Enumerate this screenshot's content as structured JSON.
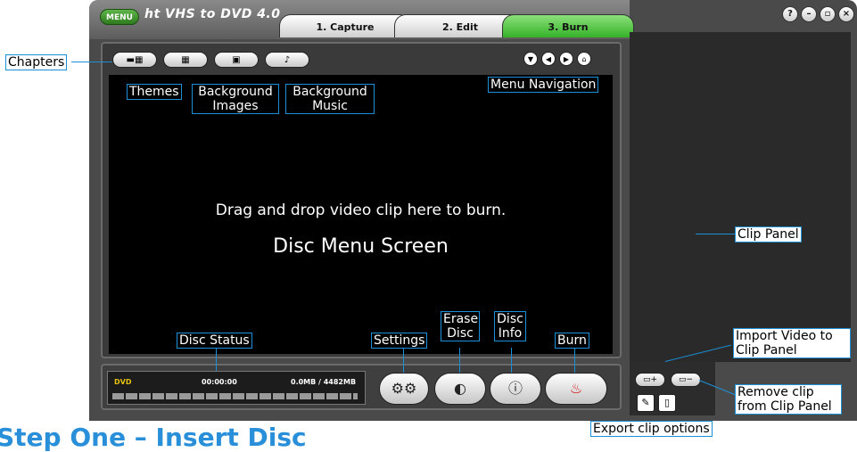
{
  "app": {
    "menu_label": "MENU",
    "logo_prefix": "ht",
    "logo_text": "VHS to DVD 4.0"
  },
  "tabs": [
    {
      "label": "1. Capture",
      "active": false
    },
    {
      "label": "2. Edit",
      "active": false
    },
    {
      "label": "3. Burn",
      "active": true
    }
  ],
  "window_controls": {
    "help": "?",
    "minimize": "–",
    "maximize": "▫",
    "close": "×"
  },
  "disc_menu": {
    "drag_text": "Drag and drop video clip here to burn.",
    "screen_title": "Disc Menu Screen"
  },
  "status": {
    "type": "DVD",
    "time": "00:00:00",
    "size": "0.0MB / 4482MB"
  },
  "icons": {
    "chapters": "chapters-icon",
    "themes": "themes-icon",
    "background_images": "image-icon",
    "background_music": "music-note-icon",
    "nav_down": "arrow-down-icon",
    "nav_left": "arrow-left-icon",
    "nav_right": "arrow-right-icon",
    "nav_home": "home-icon",
    "settings": "gear-icon",
    "erase": "erase-disc-icon",
    "info": "disc-info-icon",
    "burn": "flame-icon",
    "import": "import-clip-icon",
    "remove": "remove-clip-icon",
    "edit": "pencil-icon",
    "export": "export-icon"
  },
  "annotations": {
    "chapters": "Chapters",
    "themes": "Themes",
    "background_images": "Background Images",
    "background_music": "Background Music",
    "menu_navigation": "Menu Navigation",
    "disc_status": "Disc Status",
    "settings": "Settings",
    "erase_disc": "Erase Disc",
    "disc_info": "Disc Info",
    "burn": "Burn",
    "clip_panel": "Clip Panel",
    "import_video": "Import Video to Clip Panel",
    "remove_clip": "Remove clip from Clip Panel",
    "export_options": "Export clip options"
  },
  "heading": "Step One – Insert Disc",
  "colors": {
    "accent": "#1c8fd6",
    "active_tab": "#35b229",
    "status_label": "#e6c20f",
    "burn": "#d21919"
  }
}
